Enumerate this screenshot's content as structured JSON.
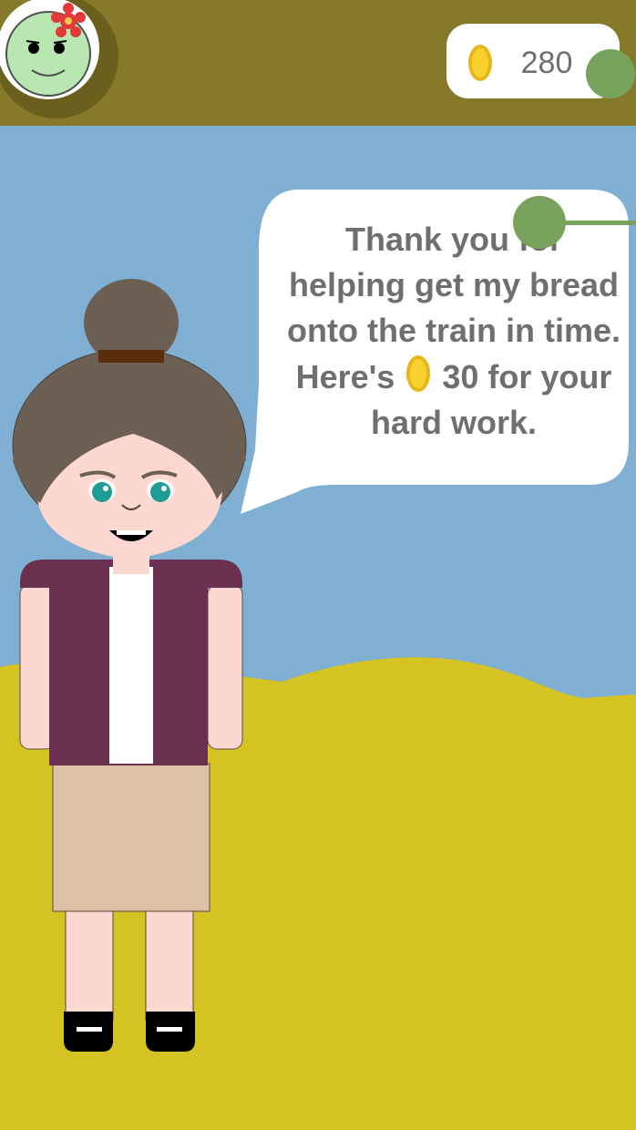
{
  "hud": {
    "coins": "280",
    "icons": {
      "avatar": "player-face-icon",
      "coin": "gold-coin-icon"
    }
  },
  "dialog": {
    "line1": "Thank you for",
    "line2": "helping get my bread",
    "line3": "onto the train in time.",
    "line4a": "Here's",
    "line4b": "30 for your",
    "line5": "hard work."
  },
  "colors": {
    "topbar": "#867a2a",
    "sky": "#7fafd2",
    "ground": "#d5c223",
    "avatar_face": "#b8e7b2",
    "hair": "#6c6054",
    "vest": "#6b3050",
    "skirt": "#dcc2a4",
    "skin": "#fcd8d0",
    "touch_indicator": "#78a35c"
  }
}
